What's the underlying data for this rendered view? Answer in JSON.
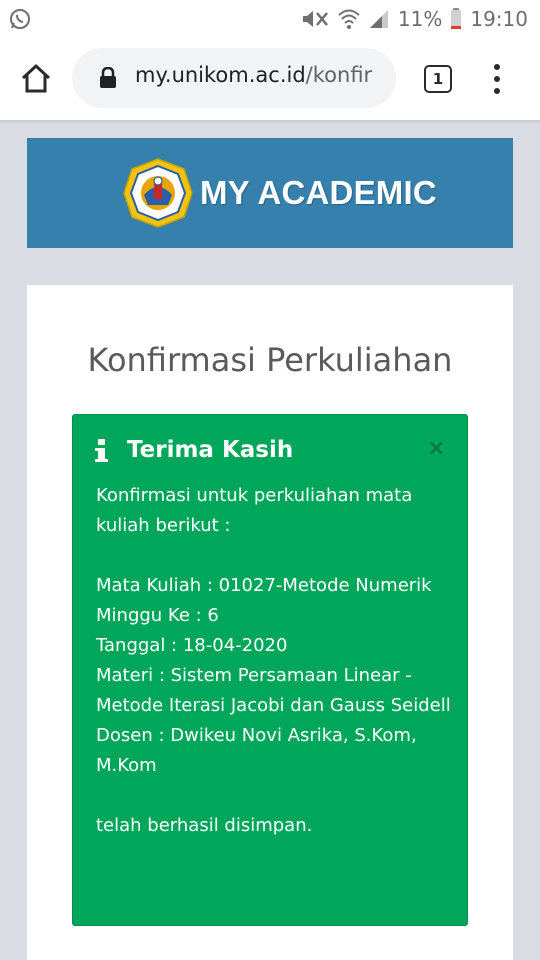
{
  "status_bar": {
    "battery_percent": "11%",
    "time": "19:10",
    "icons": [
      "whatsapp-icon",
      "mute-icon",
      "wifi-icon",
      "signal-icon",
      "battery-icon"
    ]
  },
  "browser": {
    "url_host": "my.unikom.ac.id",
    "url_path": "/konfir",
    "tab_count": "1"
  },
  "banner": {
    "title": "MY ACADEMIC",
    "color": "#3580ad"
  },
  "page": {
    "title": "Konfirmasi Perkuliahan"
  },
  "alert": {
    "title": "Terima Kasih",
    "close_label": "×",
    "color": "#00a65a",
    "lines": {
      "intro": "Konfirmasi untuk perkuliahan mata kuliah berikut :",
      "mata_kuliah": "Mata Kuliah : 01027-Metode Numerik",
      "minggu": "Minggu Ke : 6",
      "tanggal": "Tanggal : 18-04-2020",
      "materi": "Materi : Sistem Persamaan Linear - Metode Iterasi Jacobi dan Gauss Seidell",
      "dosen": "Dosen : Dwikeu Novi Asrika, S.Kom, M.Kom",
      "outro": "telah berhasil disimpan."
    }
  }
}
